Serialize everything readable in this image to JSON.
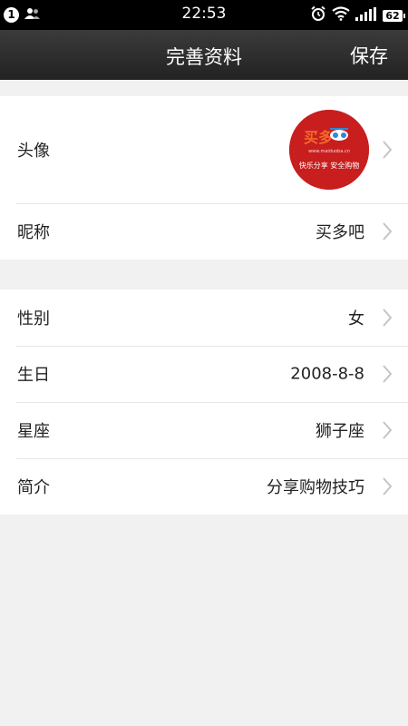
{
  "status_bar": {
    "notification_count": "1",
    "time": "22:53",
    "battery": "62",
    "icons": [
      "contacts-icon",
      "alarm-icon",
      "wifi-icon",
      "signal-icon",
      "battery-icon"
    ]
  },
  "nav": {
    "title": "完善资料",
    "save_label": "保存"
  },
  "profile": {
    "avatar_label": "头像",
    "avatar_logo_text": "买多吧",
    "avatar_logo_url": "www.maiduoba.cn",
    "avatar_slogan": "快乐分享 安全购物",
    "nickname_label": "昵称",
    "nickname_value": "买多吧"
  },
  "details": {
    "gender_label": "性别",
    "gender_value": "女",
    "birthday_label": "生日",
    "birthday_value": "2008-8-8",
    "zodiac_label": "星座",
    "zodiac_value": "狮子座",
    "bio_label": "简介",
    "bio_value": "分享购物技巧"
  },
  "colors": {
    "page_bg": "#f1f1f1",
    "navbar_bg": "#2c2c2c",
    "avatar_red": "#c81e1e",
    "chevron": "#c4c4c4"
  }
}
